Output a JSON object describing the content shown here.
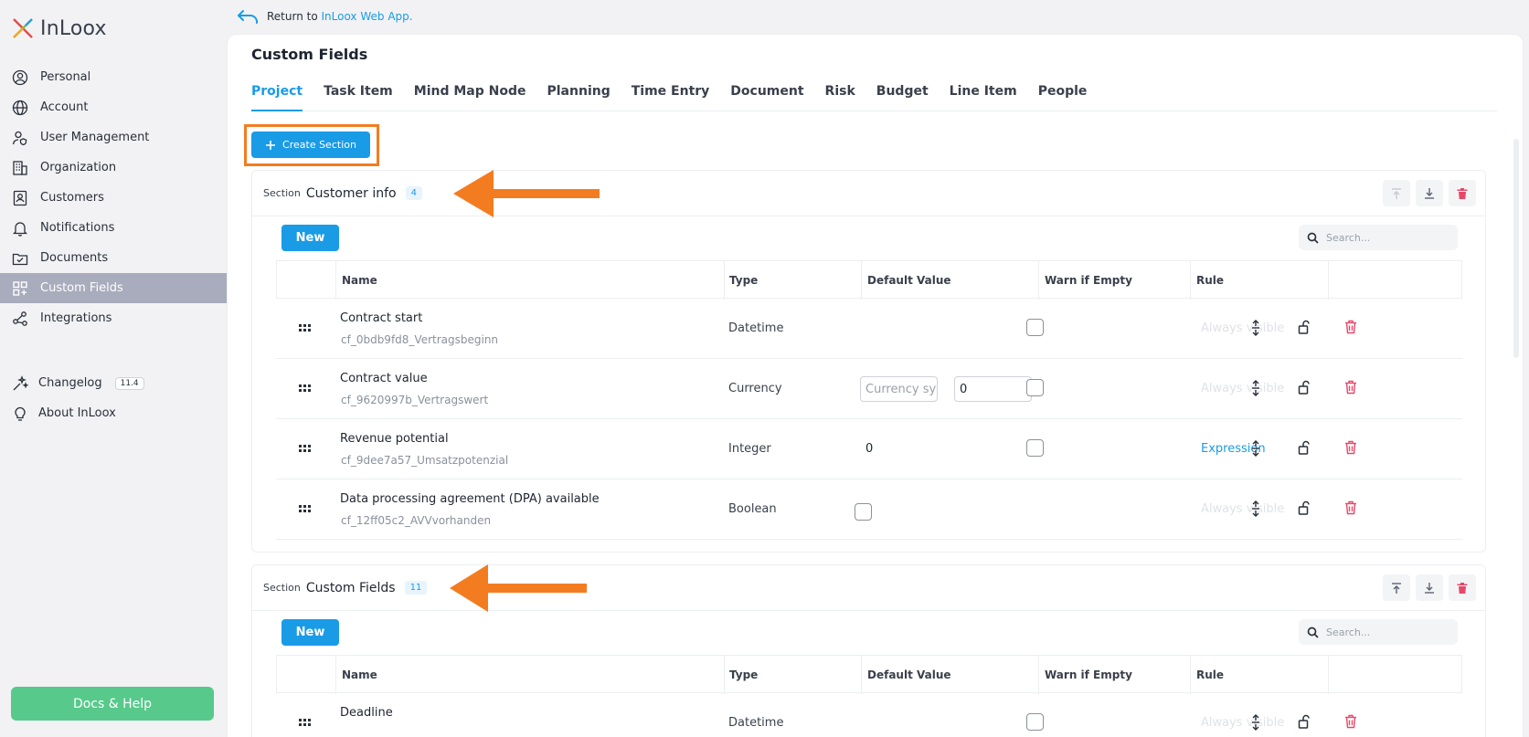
{
  "app": {
    "logo_text": "InLoox"
  },
  "sidebar": {
    "items": [
      {
        "label": "Personal",
        "icon": "user-circle-icon"
      },
      {
        "label": "Account",
        "icon": "globe-icon"
      },
      {
        "label": "User Management",
        "icon": "user-shield-icon"
      },
      {
        "label": "Organization",
        "icon": "building-icon"
      },
      {
        "label": "Customers",
        "icon": "contact-card-icon"
      },
      {
        "label": "Notifications",
        "icon": "bell-icon"
      },
      {
        "label": "Documents",
        "icon": "folder-check-icon"
      },
      {
        "label": "Custom Fields",
        "icon": "grid-plus-icon",
        "active": true
      },
      {
        "label": "Integrations",
        "icon": "share-nodes-icon"
      }
    ],
    "changelog_label": "Changelog",
    "changelog_version": "11.4",
    "about_label": "About InLoox",
    "docs_label": "Docs & Help"
  },
  "topbar": {
    "return_prefix": "Return to ",
    "return_link": "InLoox Web App."
  },
  "page": {
    "title": "Custom Fields"
  },
  "tabs": [
    "Project",
    "Task Item",
    "Mind Map Node",
    "Planning",
    "Time Entry",
    "Document",
    "Risk",
    "Budget",
    "Line Item",
    "People"
  ],
  "active_tab": "Project",
  "create_section_label": "Create Section",
  "columns": {
    "name": "Name",
    "type": "Type",
    "default": "Default Value",
    "warn": "Warn if Empty",
    "rule": "Rule"
  },
  "sections": [
    {
      "label": "Section",
      "name": "Customer info",
      "count": "4",
      "new_label": "New",
      "search_placeholder": "Search...",
      "rows": [
        {
          "name": "Contract start",
          "key": "cf_0bdb9fd8_Vertragsbeginn",
          "type": "Datetime",
          "default": "",
          "rule": "Always visible"
        },
        {
          "name": "Contract value",
          "key": "cf_9620997b_Vertragswert",
          "type": "Currency",
          "currency_placeholder": "Currency sy",
          "amount": "0",
          "rule": "Always visible"
        },
        {
          "name": "Revenue potential",
          "key": "cf_9dee7a57_Umsatzpotenzial",
          "type": "Integer",
          "default": "0",
          "rule": "Expression"
        },
        {
          "name": "Data processing agreement (DPA) available",
          "key": "cf_12ff05c2_AVVvorhanden",
          "type": "Boolean",
          "default": "",
          "rule": "Always visible"
        }
      ]
    },
    {
      "label": "Section",
      "name": "Custom Fields",
      "count": "11",
      "new_label": "New",
      "search_placeholder": "Search...",
      "rows": [
        {
          "name": "Deadline",
          "key": "",
          "type": "Datetime",
          "default": "",
          "rule": "Always visible"
        }
      ]
    }
  ],
  "colors": {
    "accent": "#1a9be6",
    "highlight": "#f47c20",
    "danger": "#e5486a",
    "docs": "#56c98b",
    "sidebar_active": "#a8acbc"
  }
}
